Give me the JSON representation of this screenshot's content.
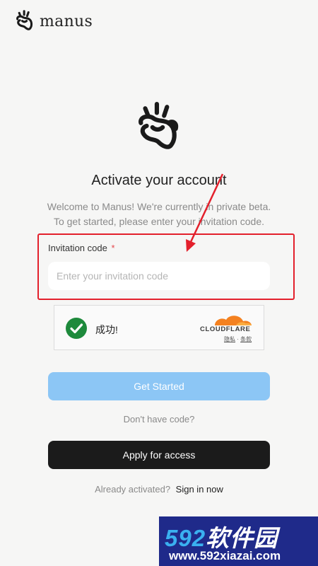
{
  "header": {
    "brand_name": "manus",
    "logo_icon": "manus-hand-icon"
  },
  "main": {
    "title": "Activate your account",
    "subtitle_line1": "Welcome to Manus! We're currently in private beta.",
    "subtitle_line2": "To get started, please enter your invitation code.",
    "invitation_label": "Invitation code",
    "required_mark": "*",
    "invitation_placeholder": "Enter your invitation code",
    "invitation_value": ""
  },
  "captcha": {
    "status_text": "成功!",
    "brand": "CLOUDFLARE",
    "privacy_link": "隐私",
    "separator": " · ",
    "terms_link": "条款",
    "check_icon": "check-circle-icon"
  },
  "actions": {
    "get_started": "Get Started",
    "no_code_prompt": "Don't have code?",
    "apply_access": "Apply for access",
    "already_activated": "Already activated?",
    "sign_in": "Sign in now"
  },
  "watermark": {
    "brand_number": "592",
    "brand_text": "软件园",
    "url": "www.592xiazai.com"
  },
  "colors": {
    "accent_disabled": "#8cc6f5",
    "dark_button": "#1b1b1b",
    "success": "#1e8a3c",
    "annotation": "#e3202c",
    "cloudflare_orange": "#f48120"
  }
}
